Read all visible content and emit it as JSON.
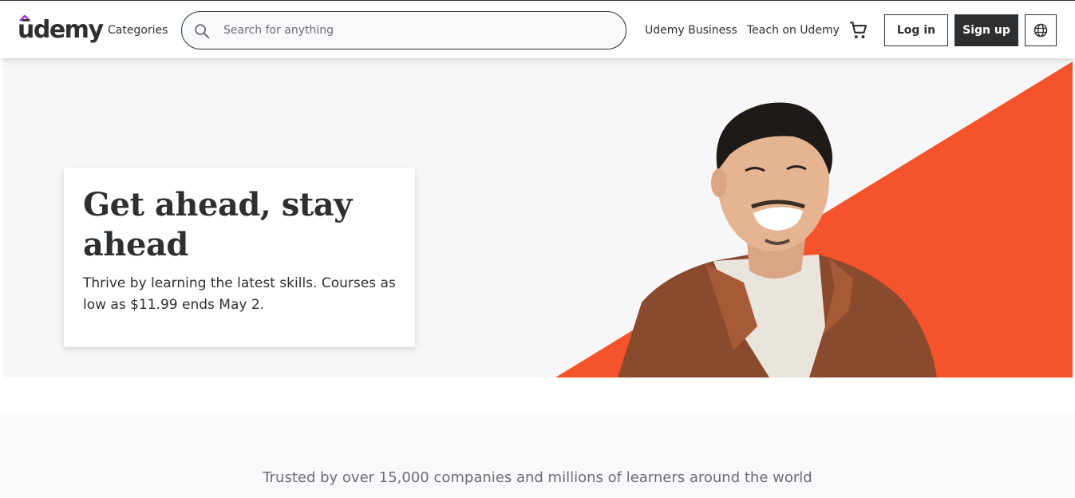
{
  "brand": {
    "name": "ūdemy",
    "accent": "#a435f0",
    "dark": "#2d2f31"
  },
  "header": {
    "categories_label": "Categories",
    "search_placeholder": "Search for anything",
    "search_value": "",
    "business_label": "Udemy Business",
    "teach_label": "Teach on Udemy",
    "cart_icon": "cart-icon",
    "login_label": "Log in",
    "signup_label": "Sign up",
    "language_icon": "globe-icon"
  },
  "hero": {
    "title": "Get ahead, stay ahead",
    "subtitle": "Thrive by learning the latest skills. Courses as low as $11.99 ends May 2.",
    "accent_color": "#f5532c",
    "background": "#f7f7f9"
  },
  "trusted": {
    "text": "Trusted by over 15,000 companies and millions of learners around the world"
  }
}
